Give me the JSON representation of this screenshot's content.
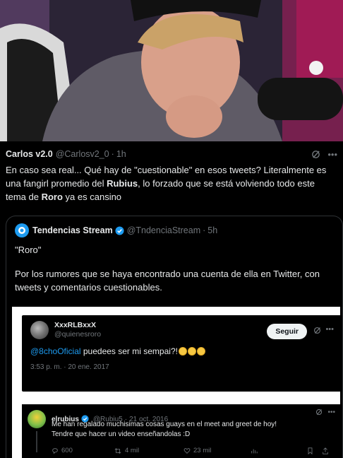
{
  "video": {
    "description_icon": "video-frame"
  },
  "tweet": {
    "name": "Carlos v2.0",
    "handle": "@Carlosv2_0",
    "separator": "·",
    "time": "1h",
    "text_parts": [
      "En caso sea real... Qué hay de \"cuestionable\" en esos tweets? Literalmente es una fangirl promedio del ",
      "Rubius",
      ", lo forzado que se está volviendo todo este tema de ",
      "Roro",
      " ya es cansino"
    ]
  },
  "quote": {
    "name": "Tendencias Stream",
    "handle": "@TndenciaStream",
    "separator": "·",
    "time": "5h",
    "line1": "\"Roro\"",
    "line2": "Por los rumores que se haya encontrado una cuenta de ella en Twitter, con tweets y comentarios cuestionables."
  },
  "embedded1": {
    "name": "XxxRLBxxX",
    "handle": "@quienesroro",
    "follow_label": "Seguir",
    "mention": "@8choOficial",
    "text": " puedees ser mi sempai?!",
    "timestamp": "3:53 p. m. · 20 ene. 2017"
  },
  "embedded2": {
    "name": "elrubius",
    "handle": "@Rubiu5",
    "separator": "·",
    "time": "21 oct. 2016",
    "body_line1": "Me han regalado muchisimas cosas guays en el meet and greet de hoy!",
    "body_line2": "Tendre que hacer un video enseñandolas :D",
    "replies": "600",
    "retweets": "4 mil",
    "likes": "23 mil"
  },
  "colors": {
    "accent": "#1d9bf0",
    "muted": "#71767b",
    "text": "#e7e9ea",
    "background": "#000000"
  }
}
